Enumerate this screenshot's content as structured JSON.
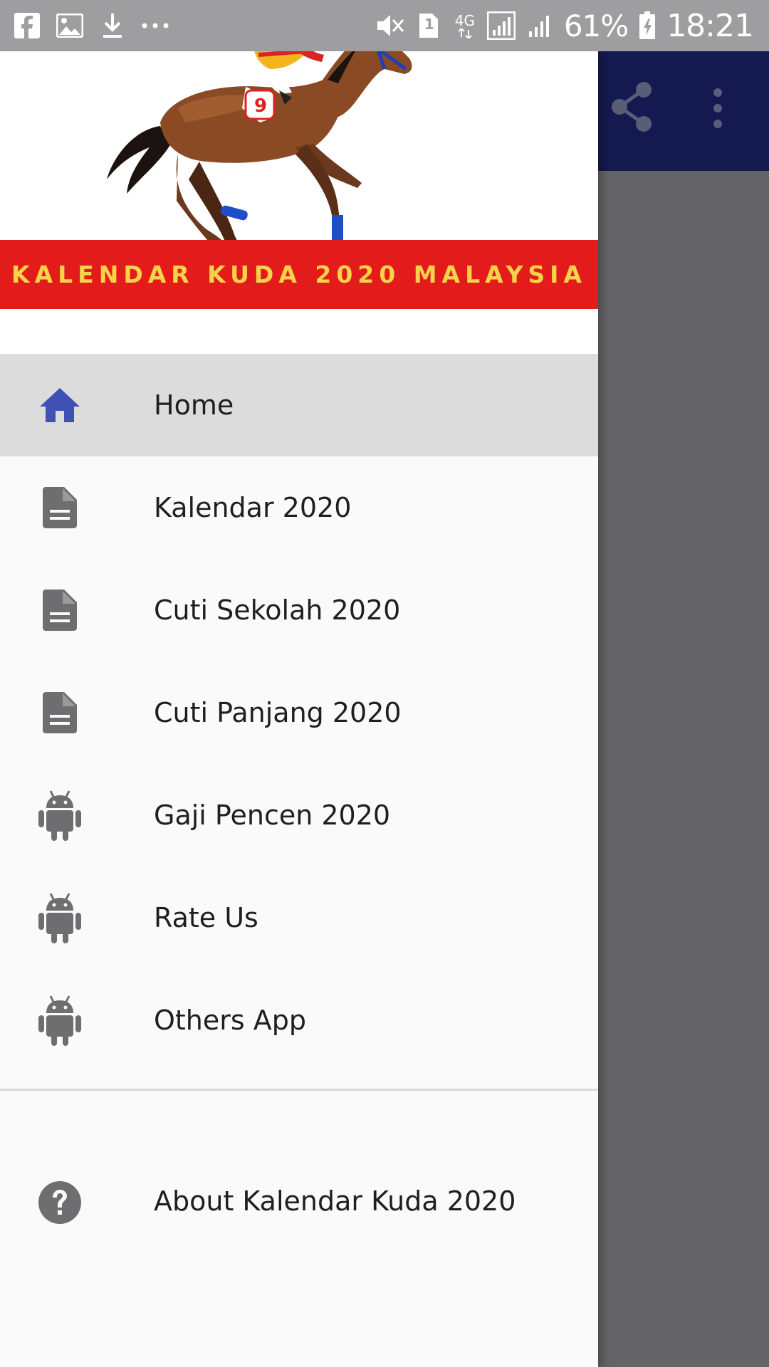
{
  "status_bar": {
    "battery_percent": "61%",
    "time": "18:21",
    "sim_indicator": "1",
    "network": "4G",
    "icons_left": [
      "facebook-icon",
      "gallery-icon",
      "download-icon",
      "more-notifications-icon"
    ],
    "icons_right": [
      "mute-icon",
      "sim-icon",
      "network-4g-icon",
      "signal-icon",
      "signal-icon",
      "battery-charging-icon"
    ]
  },
  "toolbar": {
    "color": "#141a4f",
    "actions": [
      "share-icon",
      "more-vert-icon"
    ]
  },
  "drawer": {
    "header": {
      "banner_text": "KALENDAR KUDA 2020 MALAYSIA",
      "banner_color": "#e41b1b",
      "banner_text_color": "#f8d34a"
    },
    "items": [
      {
        "label": "Home",
        "icon": "home-icon",
        "active": true
      },
      {
        "label": "Kalendar 2020",
        "icon": "document-icon",
        "active": false
      },
      {
        "label": "Cuti Sekolah 2020",
        "icon": "document-icon",
        "active": false
      },
      {
        "label": "Cuti Panjang 2020",
        "icon": "document-icon",
        "active": false
      },
      {
        "label": "Gaji Pencen 2020",
        "icon": "android-icon",
        "active": false
      },
      {
        "label": "Rate Us",
        "icon": "android-icon",
        "active": false
      },
      {
        "label": "Others App",
        "icon": "android-icon",
        "active": false
      }
    ],
    "about": {
      "label": "About Kalendar Kuda 2020",
      "icon": "help-icon"
    },
    "accent_color": "#3f51b5"
  }
}
